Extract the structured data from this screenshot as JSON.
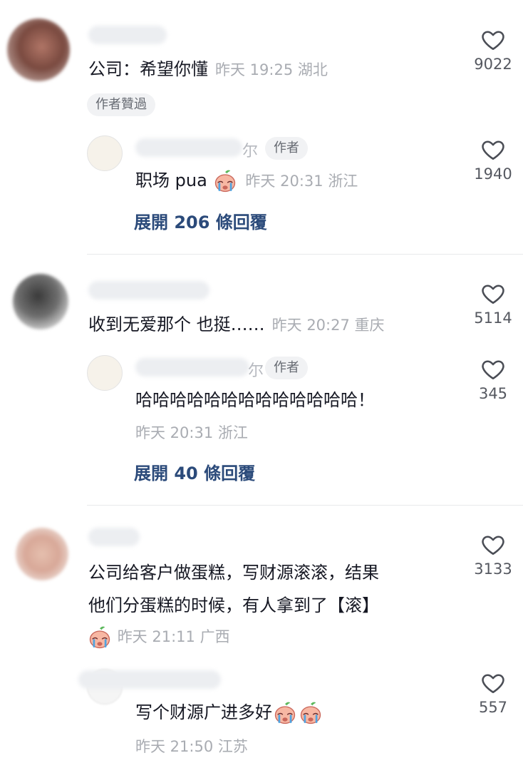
{
  "comments": [
    {
      "text": "公司：希望你懂",
      "time": "昨天 19:25",
      "location": "湖北",
      "likes": "9022",
      "badge": "作者贊過",
      "reply": {
        "name_tail": "尔",
        "author_badge": "作者",
        "text": "职场 pua",
        "time": "昨天 20:31",
        "location": "浙江",
        "likes": "1940"
      },
      "expand": "展開 206 條回覆"
    },
    {
      "text": "收到无爱那个 也挺……",
      "time": "昨天 20:27",
      "location": "重庆",
      "likes": "5114",
      "reply": {
        "name_tail": "尔",
        "author_badge": "作者",
        "text": "哈哈哈哈哈哈哈哈哈哈哈哈哈！",
        "time": "昨天 20:31",
        "location": "浙江",
        "likes": "345"
      },
      "expand": "展開 40 條回覆"
    },
    {
      "text_line1": "公司给客户做蛋糕，写财源滚滚，结果",
      "text_line2": "他们分蛋糕的时候，有人拿到了【滚】",
      "time": "昨天 21:11",
      "location": "广西",
      "likes": "3133",
      "reply": {
        "text": "写个财源广进多好",
        "time": "昨天 21:50",
        "location": "江苏",
        "likes": "557"
      }
    }
  ],
  "icons": {
    "like": "heart-outline-icon",
    "emoji": "crying-peach-emoji-icon"
  },
  "colors": {
    "link": "#2b4a7a",
    "meta": "#a9acb2",
    "text": "#161823"
  }
}
